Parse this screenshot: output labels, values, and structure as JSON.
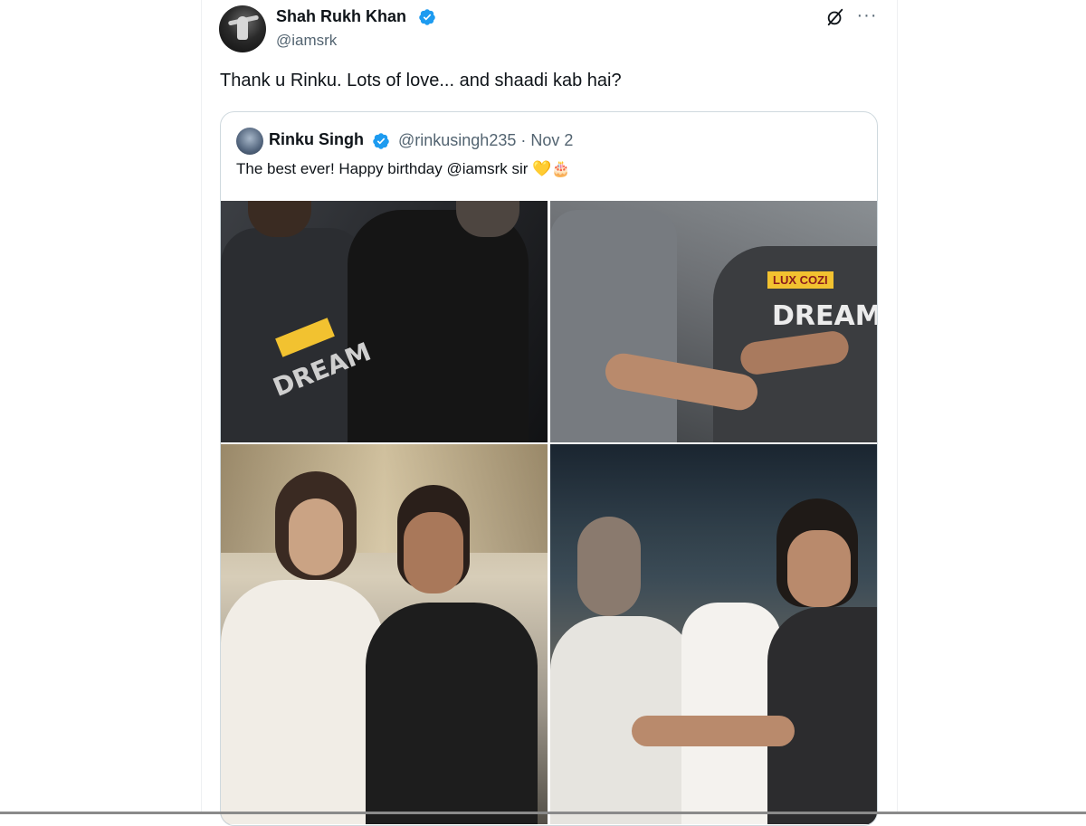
{
  "tweet": {
    "author": {
      "name": "Shah Rukh Khan",
      "handle": "@iamsrk",
      "verified": true
    },
    "text": "Thank u Rinku. Lots of love... and shaadi kab hai?",
    "icons": [
      "grok-icon",
      "more-icon"
    ],
    "more_glyph": "···"
  },
  "quoted": {
    "author": {
      "name": "Rinku Singh",
      "verified": true
    },
    "meta": "@rinkusingh235 · Nov 2",
    "text": "The best ever! Happy birthday @iamsrk sir",
    "emojis": "💛🎂",
    "photos": [
      {
        "jersey_text": "DREAM"
      },
      {
        "sponsor": "LUX COZI",
        "jersey_text": "DREAM"
      },
      {},
      {}
    ]
  },
  "colors": {
    "verified": "#1d9bf0",
    "text_primary": "#0f1419",
    "text_secondary": "#536471",
    "border": "#cfd9de"
  }
}
